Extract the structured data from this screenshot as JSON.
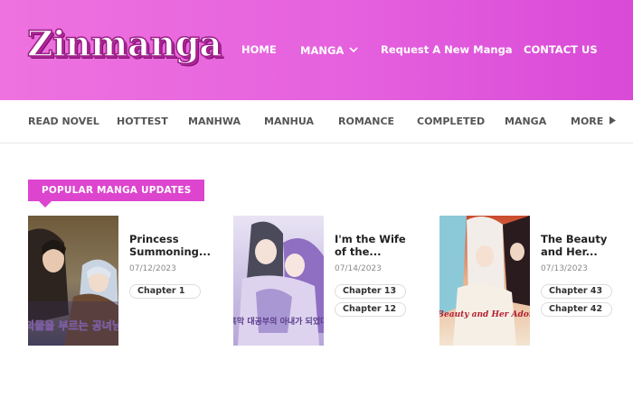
{
  "header": {
    "logo": "Zinmanga",
    "nav": [
      {
        "label": "HOME"
      },
      {
        "label": "MANGA"
      },
      {
        "label": "Request A New Manga"
      },
      {
        "label": "CONTACT US"
      }
    ]
  },
  "categories": [
    "READ NOVEL",
    "HOTTEST",
    "MANHWA",
    "MANHUA",
    "ROMANCE",
    "COMPLETED",
    "MANGA",
    "MORE"
  ],
  "section": {
    "title": "POPULAR MANGA UPDATES"
  },
  "cards": [
    {
      "title_line1": "Princess",
      "title_line2": "Summoning...",
      "date": "07/12/2023",
      "chapters": [
        "Chapter 1"
      ],
      "cover_text": "괴물을 부르는 공녀님"
    },
    {
      "title_line1": "I'm the Wife",
      "title_line2": "of the...",
      "date": "07/14/2023",
      "chapters": [
        "Chapter 13",
        "Chapter 12"
      ],
      "cover_text": "흑막 대공부의 아내가 되었다"
    },
    {
      "title_line1": "The Beauty",
      "title_line2": "and Her...",
      "date": "07/13/2023",
      "chapters": [
        "Chapter 43",
        "Chapter 42"
      ],
      "cover_text": "The Beauty and Her Adonises"
    }
  ],
  "colors": {
    "header_start": "#ee72df",
    "header_end": "#d94ad7",
    "accent": "#dd45cf"
  },
  "icons": {
    "dropdown": "chevron-down-icon",
    "more": "triangle-right-icon"
  }
}
